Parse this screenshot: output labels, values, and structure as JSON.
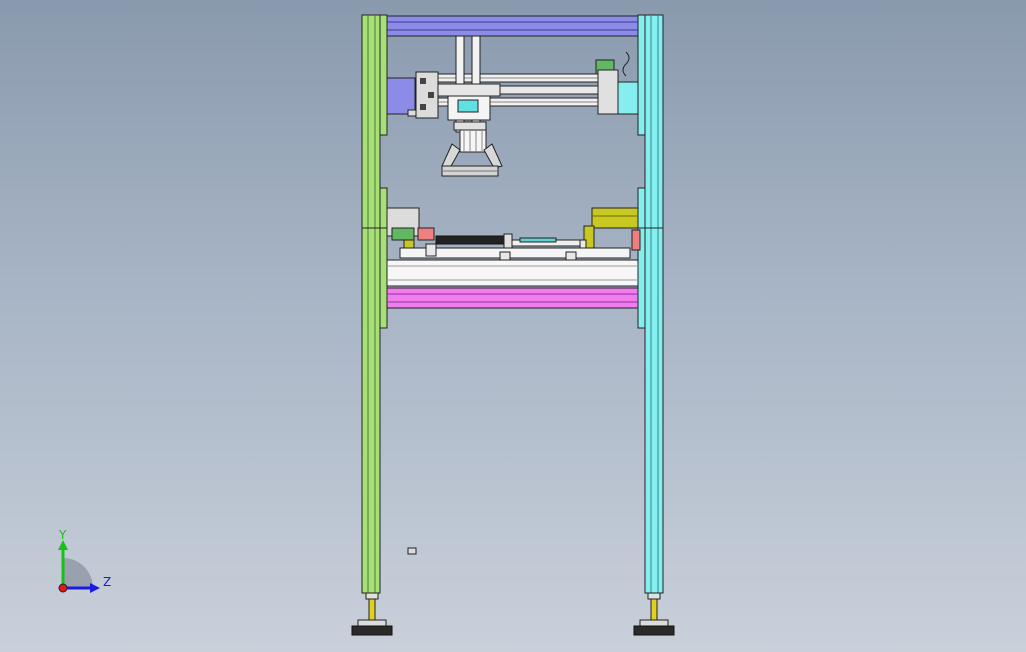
{
  "triad": {
    "y_label": "Y",
    "z_label": "Z",
    "y_color": "#18c018",
    "z_color": "#1a1ae0",
    "x_color": "#e01818"
  },
  "colors": {
    "background_top": "#8a9aae",
    "background_bottom": "#c9d0da",
    "left_column": "#a8e078",
    "right_column": "#86eeee",
    "top_beam": "#8c8ce8",
    "lower_beam": "#f07cf0",
    "leveling_foot": "#e0d020",
    "mount_bracket": "#c8c820"
  }
}
